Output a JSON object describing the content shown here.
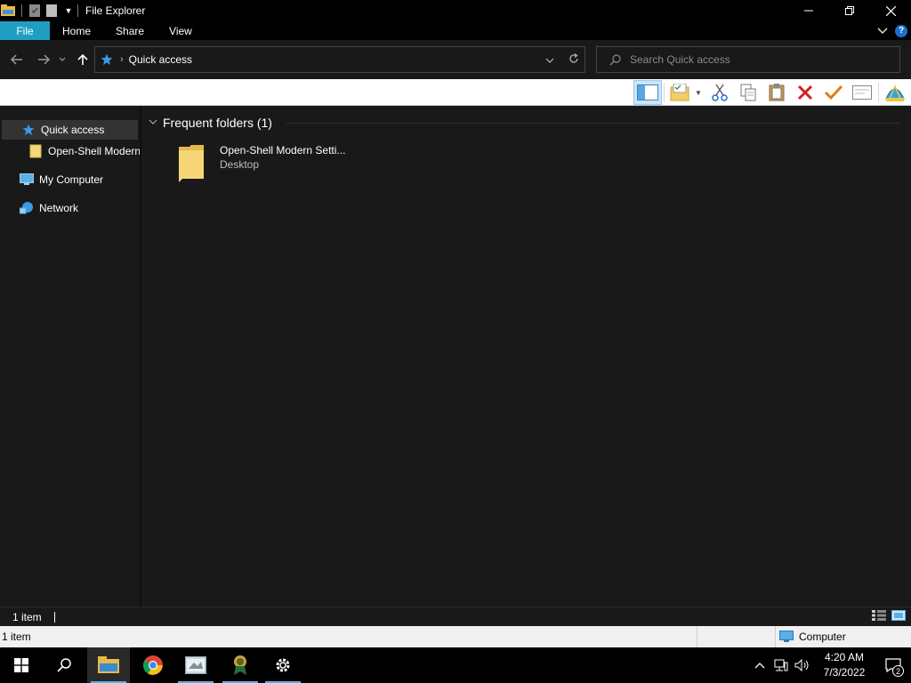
{
  "window": {
    "title": "File Explorer",
    "controls": {
      "minimize": "—",
      "restore": "❐",
      "close": "✕"
    }
  },
  "ribbon": {
    "tabs": [
      {
        "label": "File"
      },
      {
        "label": "Home"
      },
      {
        "label": "Share"
      },
      {
        "label": "View"
      }
    ],
    "help_label": "?"
  },
  "address": {
    "crumb": "Quick access",
    "search_placeholder": "Search Quick access"
  },
  "navigation_pane": {
    "items": [
      {
        "label": "Quick access"
      },
      {
        "label": "Open-Shell Modern"
      },
      {
        "label": "My Computer"
      },
      {
        "label": "Network"
      }
    ]
  },
  "content": {
    "group_header": "Frequent folders (1)",
    "folder": {
      "name": "Open-Shell Modern Setti...",
      "location": "Desktop"
    }
  },
  "status": {
    "item_count": "1 item",
    "bottom_item_count": "1 item",
    "zone_label": "Computer"
  },
  "taskbar": {
    "time": "4:20 AM",
    "date": "7/3/2022",
    "notification_count": "2"
  },
  "colors": {
    "accent_file_tab": "#1f9ec4",
    "pane_background": "#191919",
    "taskbar_running": "#5ab0e6"
  }
}
